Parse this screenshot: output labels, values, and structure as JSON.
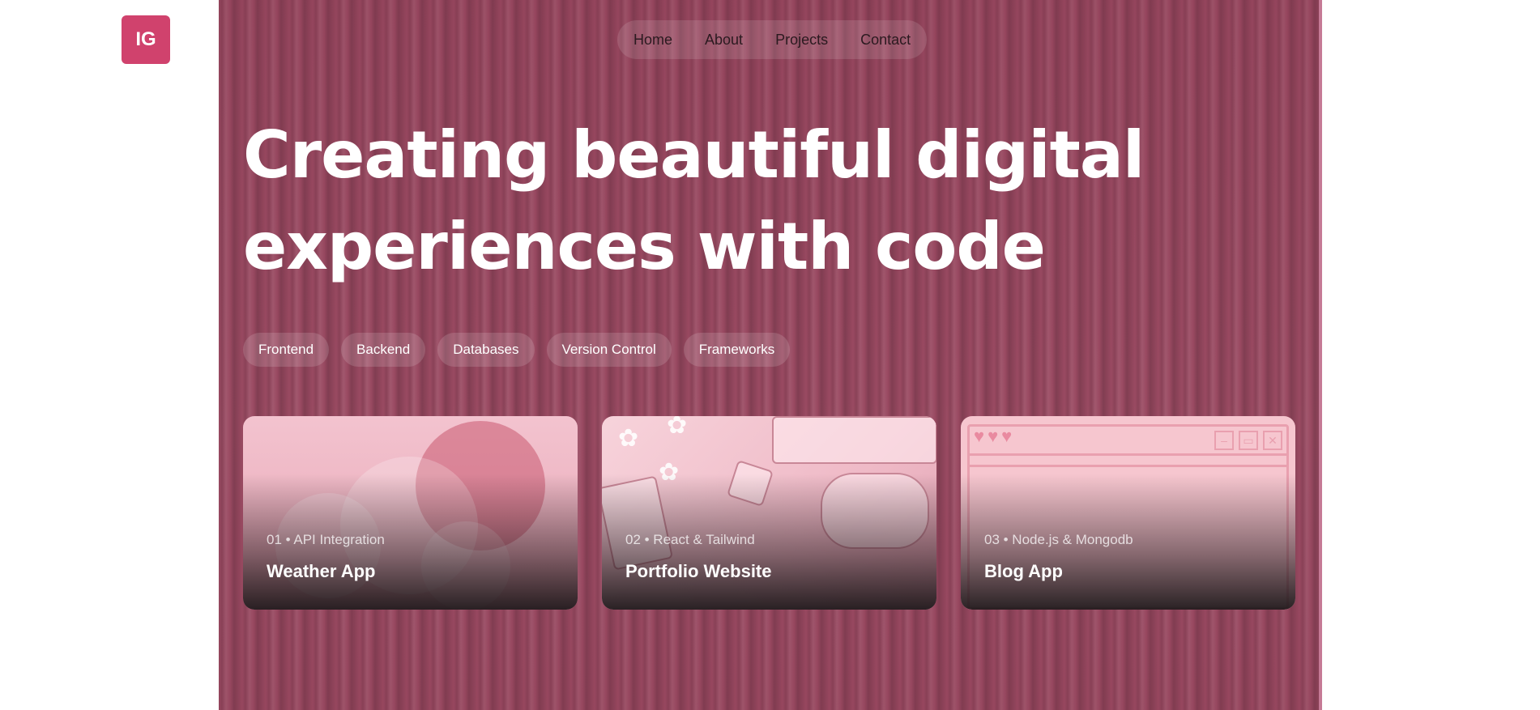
{
  "logo": {
    "text": "IG"
  },
  "nav": {
    "items": [
      {
        "label": "Home"
      },
      {
        "label": "About"
      },
      {
        "label": "Projects"
      },
      {
        "label": "Contact"
      }
    ]
  },
  "hero": {
    "headline_line1": "Creating beautiful digital",
    "headline_line2": "experiences with code"
  },
  "skills": [
    {
      "label": "Frontend"
    },
    {
      "label": "Backend"
    },
    {
      "label": "Databases"
    },
    {
      "label": "Version Control"
    },
    {
      "label": "Frameworks"
    }
  ],
  "projects": [
    {
      "meta": "01 • API Integration",
      "title": "Weather App",
      "art": "weather-illustration"
    },
    {
      "meta": "02 • React & Tailwind",
      "title": "Portfolio Website",
      "art": "desk-illustration"
    },
    {
      "meta": "03 • Node.js & Mongodb",
      "title": "Blog App",
      "art": "window-illustration"
    }
  ],
  "colors": {
    "brand": "#d0426d",
    "panel": "#9a4a62",
    "text_light": "#ffffff",
    "nav_text": "#2b1a20"
  }
}
